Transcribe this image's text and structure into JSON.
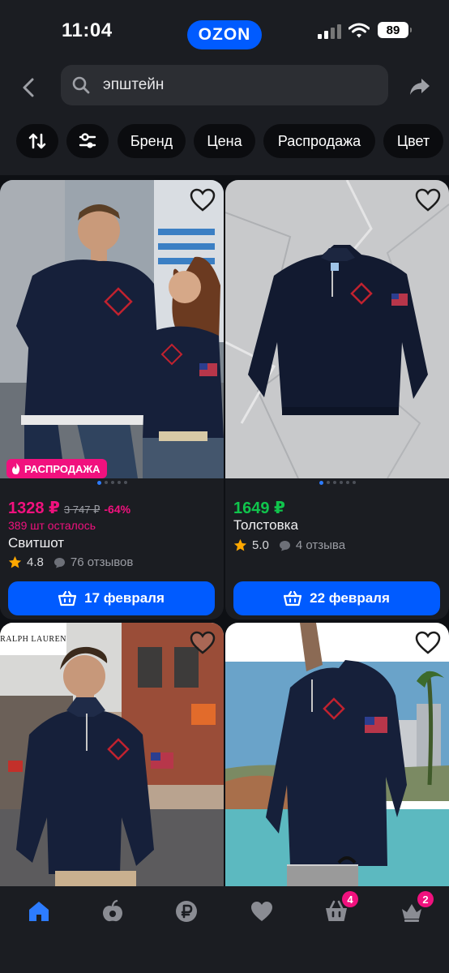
{
  "status_bar": {
    "time": "11:04",
    "logo": "OZON",
    "battery": "89"
  },
  "search": {
    "query": "эпштейн"
  },
  "filters": {
    "chips": [
      "Бренд",
      "Цена",
      "Распродажа",
      "Цвет"
    ]
  },
  "products": [
    {
      "badge": "РАСПРОДАЖА",
      "price": "1328 ₽",
      "old_price": "3 747 ₽",
      "discount": "-64%",
      "stock": "389 шт осталось",
      "title": "Свитшот",
      "rating": "4.8",
      "reviews": "76 отзывов",
      "delivery": "17 февраля",
      "price_color": "#f1117e"
    },
    {
      "price": "1649 ₽",
      "title": "Толстовка",
      "rating": "5.0",
      "reviews": "4 отзыва",
      "delivery": "22 февраля",
      "price_color": "#10c44c"
    },
    {
      "brand_logo": "RALPH LAUREN"
    },
    {}
  ],
  "tab_bar": {
    "cart_count": "4",
    "profile_count": "2"
  },
  "colors": {
    "accent": "#005bff",
    "sale": "#f1117e",
    "green": "#10c44c",
    "star": "#ffa800"
  }
}
